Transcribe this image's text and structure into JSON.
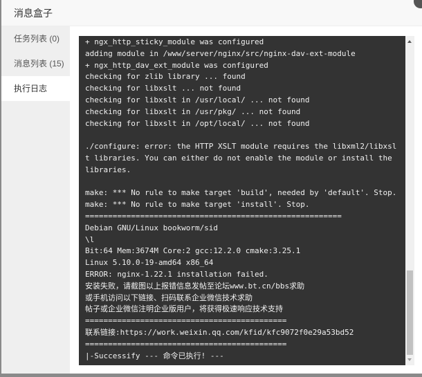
{
  "dialog": {
    "title": "消息盒子"
  },
  "sidebar": {
    "items": [
      {
        "label": "任务列表 (0)",
        "active": false
      },
      {
        "label": "消息列表 (15)",
        "active": false
      },
      {
        "label": "执行日志",
        "active": true
      }
    ]
  },
  "console": {
    "lines": [
      "+ ngx_http_sticky_module was configured",
      "adding module in /www/server/nginx/src/nginx-dav-ext-module",
      "+ ngx_http_dav_ext_module was configured",
      "checking for zlib library ... found",
      "checking for libxslt ... not found",
      "checking for libxslt in /usr/local/ ... not found",
      "checking for libxslt in /usr/pkg/ ... not found",
      "checking for libxslt in /opt/local/ ... not found",
      "",
      "./configure: error: the HTTP XSLT module requires the libxml2/libxslt libraries. You can either do not enable the module or install the libraries.",
      "",
      "make: *** No rule to make target 'build', needed by 'default'. Stop.",
      "make: *** No rule to make target 'install'. Stop.",
      "========================================================",
      "Debian GNU/Linux bookworm/sid",
      "\\l",
      "Bit:64 Mem:3674M Core:2 gcc:12.2.0 cmake:3.25.1",
      "Linux 5.10.0-19-amd64 x86_64",
      "ERROR: nginx-1.22.1 installation failed.",
      "安装失败，请截图以上报错信息发帖至论坛www.bt.cn/bbs求助",
      "或手机访问以下链接、扫码联系企业微信技术求助",
      "帖子或企业微信注明企业版用户，将获得极速响应技术支持",
      "============================================",
      "联系链接:https://work.weixin.qq.com/kfid/kfc9072f0e29a53bd52",
      "============================================",
      "|-Successify --- 命令已执行! ---"
    ]
  },
  "colors": {
    "console_bg": "#333333",
    "console_text": "#f0f0f0",
    "sidebar_bg": "#efefef"
  }
}
